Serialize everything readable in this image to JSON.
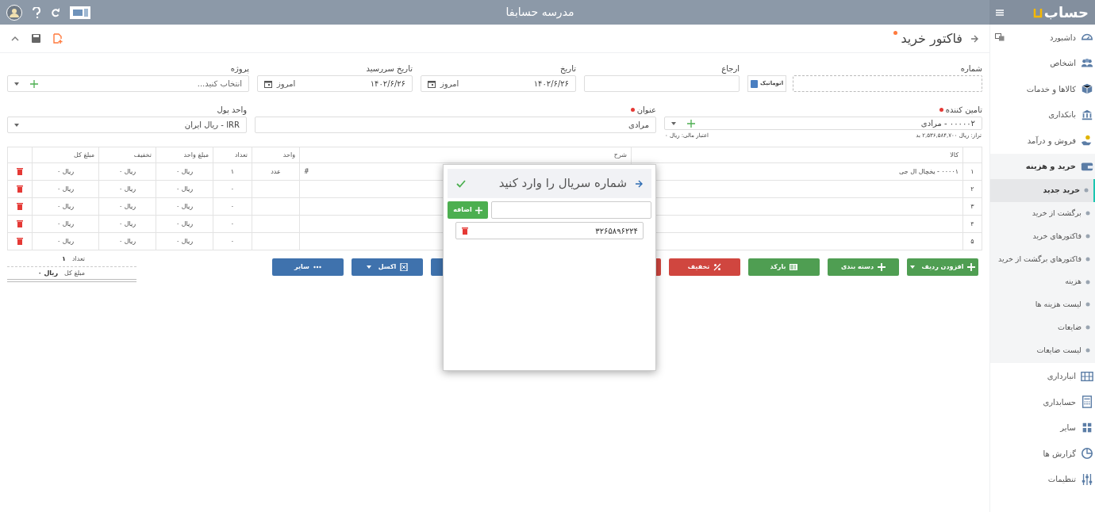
{
  "top_bar": {
    "logo": "حساب",
    "title": "مدرسه حسابفا"
  },
  "sidebar": {
    "items": [
      {
        "label": "داشبورد",
        "kind": "gauge",
        "expanded": false
      },
      {
        "label": "اشخاص",
        "kind": "people",
        "expanded": false
      },
      {
        "label": "کالاها و خدمات",
        "kind": "box",
        "expanded": false
      },
      {
        "label": "بانکداری",
        "kind": "bank",
        "expanded": false
      },
      {
        "label": "فروش و درآمد",
        "kind": "hand",
        "expanded": false
      },
      {
        "label": "خرید و هزینه",
        "kind": "wallet",
        "expanded": true,
        "children": [
          {
            "label": "خرید جدید",
            "selected": true
          },
          {
            "label": "برگشت از خرید",
            "selected": false
          },
          {
            "label": "فاکتورهای خرید",
            "selected": false
          },
          {
            "label": "فاکتورهای برگشت از خرید",
            "selected": false
          },
          {
            "label": "هزینه",
            "selected": false
          },
          {
            "label": "لیست هزینه ها",
            "selected": false
          },
          {
            "label": "ضایعات",
            "selected": false
          },
          {
            "label": "لیست ضایعات",
            "selected": false
          }
        ]
      },
      {
        "label": "انبارداری",
        "kind": "shelf",
        "expanded": false
      },
      {
        "label": "حسابداری",
        "kind": "calculator",
        "expanded": false
      },
      {
        "label": "سایر",
        "kind": "apps",
        "expanded": false
      },
      {
        "label": "گزارش ها",
        "kind": "pie",
        "expanded": false
      },
      {
        "label": "تنظیمات",
        "kind": "sliders",
        "expanded": false
      }
    ]
  },
  "page_header": {
    "title": "فاکتور خرید",
    "modified": true
  },
  "form": {
    "fields": [
      {
        "kind": "number",
        "label": "شماره",
        "required": false,
        "auto_label": "اتوماتیک",
        "auto": true
      },
      {
        "kind": "text",
        "label": "ارجاع",
        "required": false
      },
      {
        "kind": "date",
        "label": "تاریخ",
        "required": false,
        "value": "۱۴۰۲/۶/۲۶",
        "today": "امروز"
      },
      {
        "kind": "date",
        "label": "تاریخ سررسید",
        "required": false,
        "value": "۱۴۰۲/۶/۲۶",
        "today": "امروز"
      },
      {
        "kind": "select",
        "label": "پروژه",
        "required": false,
        "placeholder": "انتخاب کنید...",
        "addable": true
      },
      {
        "kind": "select",
        "label": "تامین کننده",
        "required": true,
        "value": "۰۰۰۰۰۲ - مرادی",
        "addable": true,
        "notes": [
          "تراز: ریال ۲,۵۳۶,۵۸۴,۷۰۰ بد",
          "اعتبار مالی: ریال ۰"
        ]
      },
      {
        "kind": "text",
        "label": "عنوان",
        "required": true,
        "value": "مرادی"
      },
      {
        "kind": "select",
        "label": "واحد پول",
        "required": false,
        "value": "IRR - ریال ایران",
        "addable": false
      }
    ]
  },
  "table": {
    "columns": [
      "کالا",
      "شرح",
      "واحد",
      "تعداد",
      "مبلغ واحد",
      "تخفیف",
      "مبلغ کل"
    ],
    "rows": [
      {
        "number": "۱",
        "item": "۰۰۰۰۱ - یخچال ال جی",
        "description": "#",
        "unit": "عدد",
        "quantity": "۱",
        "unit_price": "ریال ۰",
        "discount": "ریال ۰",
        "total": "ریال ۰"
      },
      {
        "number": "۲",
        "quantity": "۰",
        "unit_price": "ریال ۰",
        "discount": "ریال ۰",
        "total": "ریال ۰"
      },
      {
        "number": "۳",
        "quantity": "۰",
        "unit_price": "ریال ۰",
        "discount": "ریال ۰",
        "total": "ریال ۰"
      },
      {
        "number": "۴",
        "quantity": "۰",
        "unit_price": "ریال ۰",
        "discount": "ریال ۰",
        "total": "ریال ۰"
      },
      {
        "number": "۵",
        "quantity": "۰",
        "unit_price": "ریال ۰",
        "discount": "ریال ۰",
        "total": "ریال ۰"
      }
    ]
  },
  "buttons": [
    {
      "label": "افزودن ردیف",
      "kind": "add",
      "color": "#4f9e52",
      "dropdown": true
    },
    {
      "label": "دسته بندی",
      "kind": "add",
      "color": "#4f9e52",
      "dropdown": false
    },
    {
      "label": "بارکد",
      "kind": "barcode",
      "color": "#4f9e52",
      "dropdown": false
    },
    {
      "label": "تخفیف",
      "kind": "discount",
      "color": "#d0463f",
      "dropdown": false
    },
    {
      "kind": "covered",
      "color": "#d0463f"
    },
    {
      "kind": "covered",
      "color": "#3f72ad"
    },
    {
      "label": "اکسل",
      "kind": "excel",
      "color": "#3f72ad",
      "dropdown": true
    },
    {
      "label": "سایر",
      "kind": "more",
      "color": "#3f72ad",
      "dropdown": false
    }
  ],
  "totals": [
    {
      "label": "تعداد",
      "value": "۱"
    },
    {
      "label": "مبلغ کل",
      "value": "ریال ۰"
    }
  ],
  "modal": {
    "title": "شماره سریال را وارد کنید",
    "add_label": "اضافه",
    "serials": [
      "۳۲۶۵۸۹۶۲۲۴"
    ]
  }
}
